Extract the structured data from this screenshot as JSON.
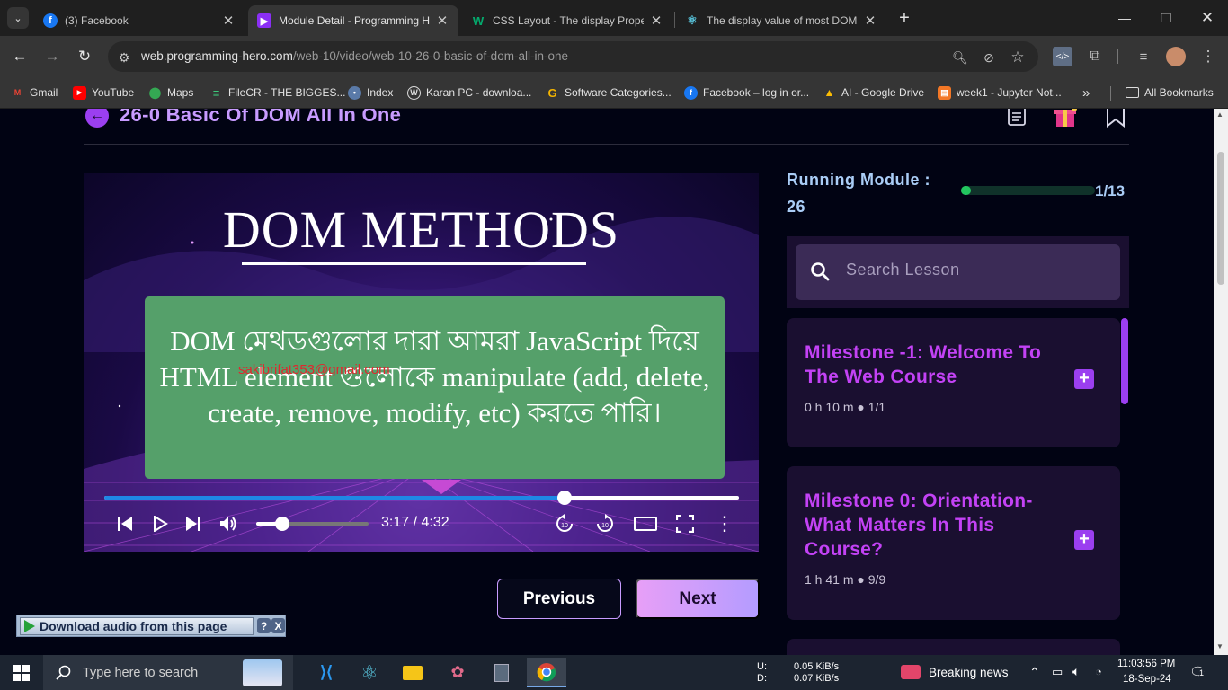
{
  "browser": {
    "tabs": [
      {
        "title": "(3) Facebook",
        "icon": "facebook-icon",
        "color": "#1877f2"
      },
      {
        "title": "Module Detail - Programming Hero",
        "icon": "programming-hero-icon",
        "color": "#8b2ff5"
      },
      {
        "title": "CSS Layout - The display Property",
        "icon": "w3schools-icon",
        "color": "#04aa6d"
      },
      {
        "title": "The display value of most DOM",
        "icon": "react-icon",
        "color": "#58c4dc"
      }
    ],
    "url_host": "web.programming-hero.com",
    "url_path": "/web-10/video/web-10-26-0-basic-of-dom-all-in-one",
    "bookmarks": [
      {
        "label": "Gmail",
        "icon": "gmail-icon"
      },
      {
        "label": "YouTube",
        "icon": "youtube-icon"
      },
      {
        "label": "Maps",
        "icon": "maps-icon"
      },
      {
        "label": "FileCR - THE BIGGES...",
        "icon": "filecr-icon"
      },
      {
        "label": "Index",
        "icon": "index-icon"
      },
      {
        "label": "Karan PC - downloa...",
        "icon": "wordpress-icon"
      },
      {
        "label": "Software Categories...",
        "icon": "google-icon"
      },
      {
        "label": "Facebook – log in or...",
        "icon": "facebook-icon"
      },
      {
        "label": "AI - Google Drive",
        "icon": "google-drive-icon"
      },
      {
        "label": "week1 - Jupyter Not...",
        "icon": "jupyter-icon"
      }
    ],
    "all_bookmarks": "All Bookmarks"
  },
  "page": {
    "module_title": "26-0 Basic Of DOM All In One",
    "video": {
      "heading": "DOM METHODS",
      "line1": "DOM মেথডগুলোর দারা আমরা JavaScript দিয়ে",
      "line2": "HTML element গুলোকে manipulate (add, delete,",
      "line3": "create, remove, modify, etc) করতে পারি।",
      "watermark": "sakibrifat353@gmail.com",
      "time": "3:17 / 4:32",
      "progress": 0.7252,
      "volume": 0.23
    },
    "previous_label": "Previous",
    "next_label": "Next",
    "running_module_label": "Running Module :",
    "running_module_number": "26",
    "running_count": "1/13",
    "running_progress": 0.077,
    "search_placeholder": "Search Lesson",
    "milestones": [
      {
        "title": "Milestone -1: Welcome To The Web Course",
        "duration": "0 h 10 m",
        "count": "1/1"
      },
      {
        "title": "Milestone 0: Orientation- What Matters In This Course?",
        "duration": "1 h 41 m",
        "count": "9/9"
      }
    ]
  },
  "download_bar": {
    "label": "Download audio from this page",
    "help": "?",
    "close": "X"
  },
  "taskbar": {
    "search_text": "Type here to search",
    "net_up_label": "U:",
    "net_down_label": "D:",
    "net_up": "0.05 KiB/s",
    "net_down": "0.07 KiB/s",
    "news": "Breaking news",
    "time": "11:03:56 PM",
    "date": "18-Sep-24",
    "notifications": "1"
  }
}
